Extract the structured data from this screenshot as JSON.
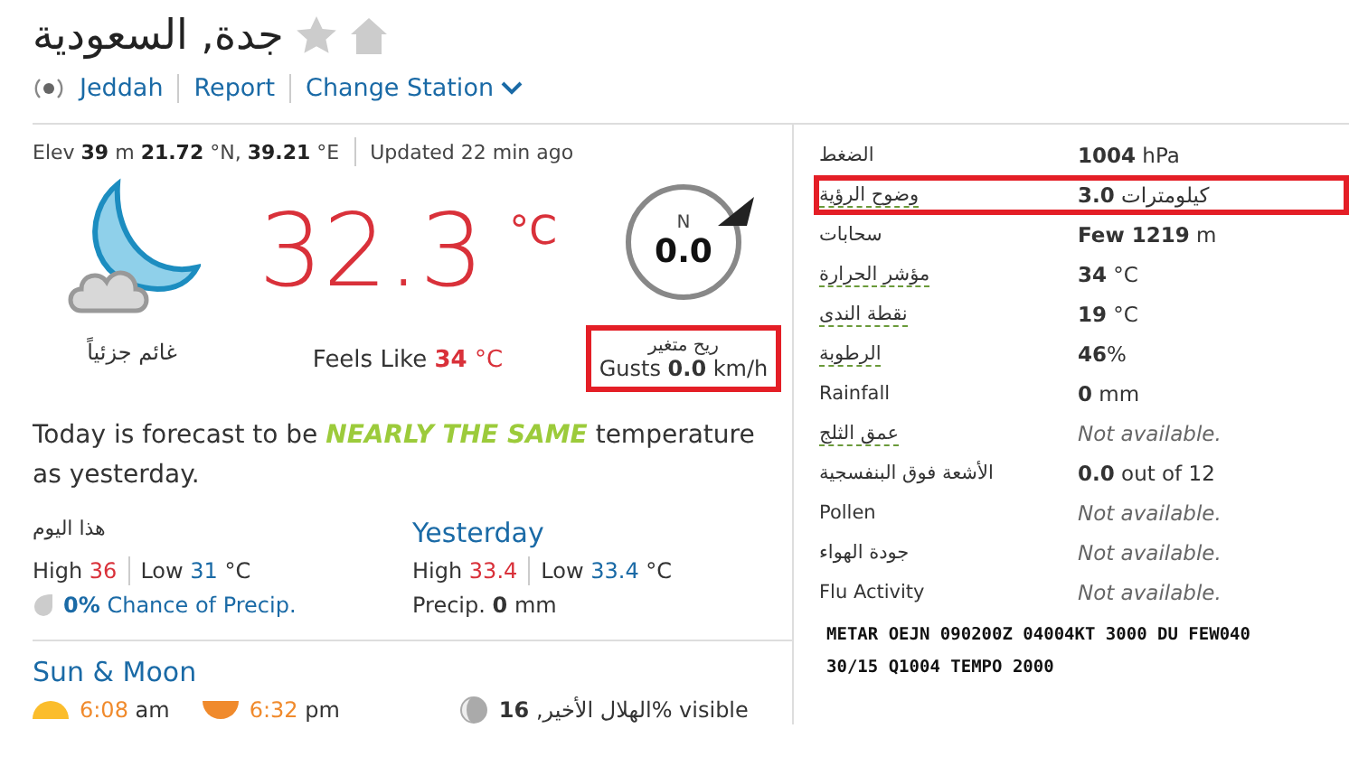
{
  "header": {
    "title": "جدة, السعودية",
    "links": [
      {
        "text": "Jeddah",
        "kind": "station"
      },
      {
        "text": "Report",
        "kind": "link"
      },
      {
        "text": "Change Station",
        "kind": "dropdown"
      }
    ],
    "meta": "Elev **39** m **21.72** °N, **39.21** °E",
    "updated": "Updated 22 min ago"
  },
  "current": {
    "condition": "غائم جزئياً",
    "temp": "32.3",
    "unit": "°C",
    "feels_label": "Feels Like",
    "feels_value": "34",
    "feels_unit": "°C",
    "wind_dir": "N",
    "wind_speed": "0.0",
    "wind_desc": "ريح متغير",
    "gusts": "Gusts **0.0** km/h",
    "highlighted": true
  },
  "forecast": {
    "before": "Today is forecast to be",
    "emphasis": "NEARLY THE SAME",
    "after": "temperature as yesterday."
  },
  "today": {
    "title": "هذا اليوم",
    "high_label": "High",
    "high": "36",
    "low_label": "Low",
    "low": "31",
    "unit": "°C",
    "precip": "0%",
    "precip_label": "Chance of Precip."
  },
  "yesterday": {
    "title": "Yesterday",
    "high_label": "High",
    "high": "33.4",
    "low_label": "Low",
    "low": "33.4",
    "unit": "°C",
    "precip": "Precip. **0** mm"
  },
  "sun_moon": {
    "title": "Sun & Moon",
    "sunrise": "6:08",
    "sunrise_suffix": "am",
    "sunset": "6:32",
    "sunset_suffix": "pm",
    "moon_value": "16",
    "moon_phase": "الهلال الأخير,",
    "moon_suffix": "% visible"
  },
  "conditions": [
    {
      "label": "الضغط",
      "value": "**1004** hPa",
      "kind": "value",
      "underlined": false,
      "highlighted": false
    },
    {
      "label": "وضوح الرؤية",
      "value": "**3.0** كيلومترات",
      "kind": "value",
      "underlined": true,
      "highlighted": true
    },
    {
      "label": "سحابات",
      "value": "**Few 1219** m",
      "kind": "value",
      "underlined": false,
      "highlighted": false
    },
    {
      "label": "مؤشر الحرارة",
      "value": "**34** °C",
      "kind": "value",
      "underlined": true,
      "highlighted": false
    },
    {
      "label": "نقطة الندى",
      "value": "**19** °C",
      "kind": "value",
      "underlined": true,
      "highlighted": false
    },
    {
      "label": "الرطوبة",
      "value": "**46**%",
      "kind": "value",
      "underlined": true,
      "highlighted": false
    },
    {
      "label": "Rainfall",
      "value": "**0** mm",
      "kind": "value",
      "underlined": false,
      "highlighted": false
    },
    {
      "label": "عمق الثلج",
      "value": "Not available.",
      "kind": "na",
      "underlined": true,
      "highlighted": false
    },
    {
      "label": "الأشعة فوق البنفسجية",
      "value": "**0.0** out of 12",
      "kind": "value",
      "underlined": false,
      "highlighted": false
    },
    {
      "label": "Pollen",
      "value": "Not available.",
      "kind": "na",
      "underlined": false,
      "highlighted": false
    },
    {
      "label": "جودة الهواء",
      "value": "Not available.",
      "kind": "na",
      "underlined": false,
      "highlighted": false
    },
    {
      "label": "Flu Activity",
      "value": "Not available.",
      "kind": "na",
      "underlined": false,
      "highlighted": false
    }
  ],
  "metar": [
    "METAR OEJN 090200Z 04004KT 3000 DU FEW040",
    "30/15 Q1004 TEMPO 2000"
  ]
}
